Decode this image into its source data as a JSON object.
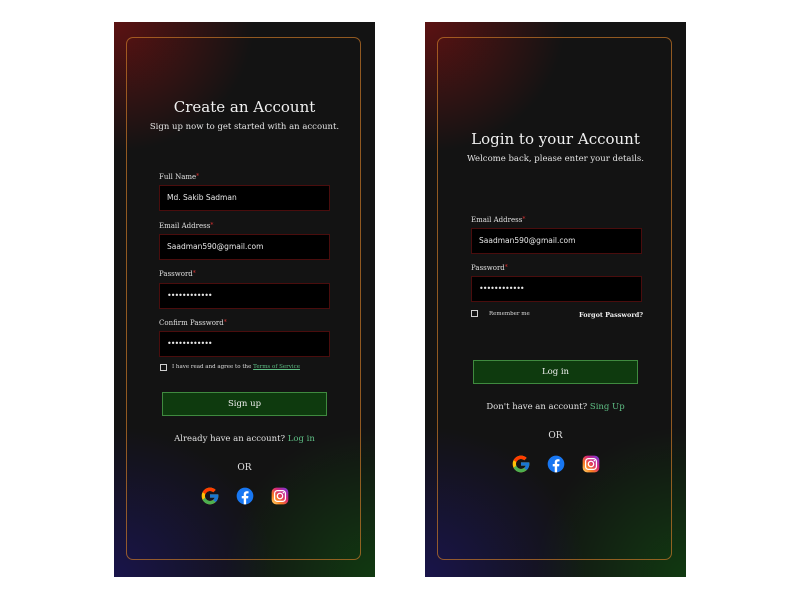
{
  "signup": {
    "title": "Create an Account",
    "subtitle": "Sign up now to get started with an account.",
    "fields": [
      {
        "label": "Full Name",
        "value": "Md. Sakib Sadman"
      },
      {
        "label": "Email Address",
        "value": "Saadman590@gmail.com"
      },
      {
        "label": "Password",
        "value": "••••••••••••"
      },
      {
        "label": "Confirm Password",
        "value": "••••••••••••"
      }
    ],
    "required_mark": "*",
    "terms_text": "I have read and agree to the",
    "terms_link": "Terms of Service",
    "button_label": "Sign up",
    "already_text": "Already have an account?",
    "login_link": "Log in",
    "or_text": "OR"
  },
  "login": {
    "title": "Login to your Account",
    "subtitle": "Welcome back, please enter your details.",
    "fields": [
      {
        "label": "Email Address",
        "value": "Saadman590@gmail.com"
      },
      {
        "label": "Password",
        "value": "••••••••••••"
      }
    ],
    "required_mark": "*",
    "remember_label": "Remember me",
    "forgot_label": "Forgot Password?",
    "button_label": "Log in",
    "no_account_text": "Don't have an account?",
    "signup_link": "Sing Up",
    "or_text": "OR"
  },
  "social_icons": [
    "google-icon",
    "facebook-icon",
    "instagram-icon"
  ],
  "colors": {
    "accent_green": "#5fbf85",
    "button_bg": "#0e3a0e",
    "input_border": "#4a0d0d",
    "required": "#d83030",
    "card_border": "#c87828"
  }
}
